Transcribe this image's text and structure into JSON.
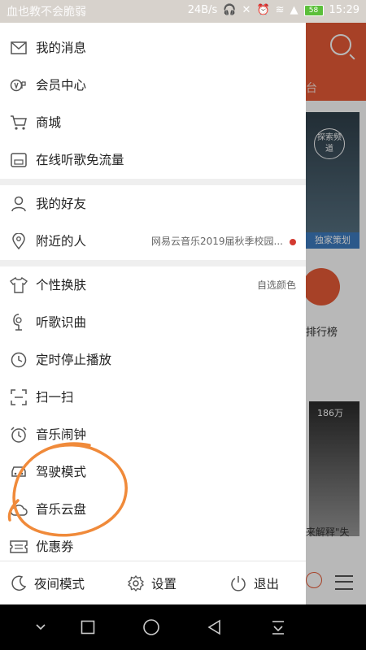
{
  "status_bar": {
    "left_text": "血也教不会脆弱",
    "network_speed": "24B/s",
    "battery": "58",
    "time": "15:29"
  },
  "drawer": {
    "group1": [
      {
        "label": "我的消息",
        "icon": "mail-icon"
      },
      {
        "label": "会员中心",
        "icon": "vip-icon"
      },
      {
        "label": "商城",
        "icon": "cart-icon"
      },
      {
        "label": "在线听歌免流量",
        "icon": "sim-card-icon"
      }
    ],
    "group2": [
      {
        "label": "我的好友",
        "icon": "person-icon"
      },
      {
        "label": "附近的人",
        "icon": "location-pin-icon",
        "right_text": "网易云音乐2019届秋季校园..."
      }
    ],
    "group3": [
      {
        "label": "个性换肤",
        "icon": "tshirt-icon",
        "right_text": "自选颜色"
      },
      {
        "label": "听歌识曲",
        "icon": "microphone-icon"
      },
      {
        "label": "定时停止播放",
        "icon": "clock-icon"
      },
      {
        "label": "扫一扫",
        "icon": "scan-icon"
      },
      {
        "label": "音乐闹钟",
        "icon": "alarm-clock-icon"
      },
      {
        "label": "驾驶模式",
        "icon": "car-icon"
      },
      {
        "label": "音乐云盘",
        "icon": "cloud-icon"
      },
      {
        "label": "优惠券",
        "icon": "coupon-icon"
      }
    ],
    "bottom": {
      "night_mode": "夜间模式",
      "settings": "设置",
      "logout": "退出"
    }
  },
  "background_app": {
    "tab_partial": "台",
    "explore_badge": "探索频道",
    "banner_strip": "独家策划",
    "rank_label": "排行榜",
    "play_count": "186万",
    "album_text": "来解释\"失"
  },
  "colors": {
    "accent": "#e85a36",
    "annotation": "#f08a3a",
    "separator": "#efefef"
  }
}
